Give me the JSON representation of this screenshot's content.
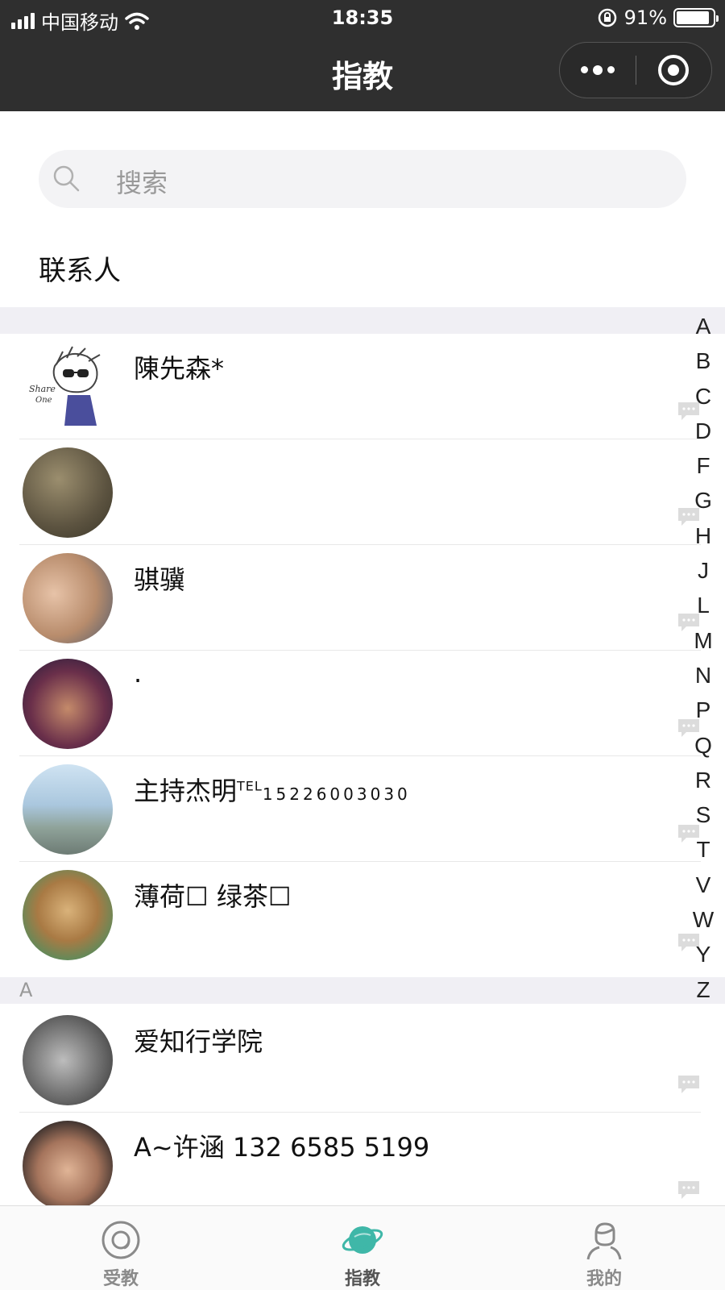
{
  "status_bar": {
    "carrier": "中国移动",
    "time": "18:35",
    "battery": "91%",
    "battery_level": 0.91
  },
  "navbar": {
    "title": "指教"
  },
  "search": {
    "placeholder": "搜索"
  },
  "contacts_section": {
    "title": "联系人"
  },
  "groups": [
    {
      "label": "",
      "contacts": [
        {
          "name": "陳先森*",
          "avatar": "cartoon-sunglasses-avatar"
        },
        {
          "name": "",
          "avatar": "photo-avatar"
        },
        {
          "name": "骐骥",
          "avatar": "photo-avatar"
        },
        {
          "name": "·",
          "avatar": "photo-avatar"
        },
        {
          "name": "主持杰明",
          "name_sup": "TEL",
          "name_tel": "15226003030",
          "avatar": "photo-avatar"
        },
        {
          "name": "薄荷☐ 绿茶☐",
          "avatar": "teddy-bear-avatar"
        }
      ]
    },
    {
      "label": "A",
      "contacts": [
        {
          "name": "爱知行学院",
          "avatar": "photo-avatar"
        },
        {
          "name": "A~许涵 132 6585 5199",
          "avatar": "photo-avatar"
        }
      ]
    }
  ],
  "index_letters": [
    "A",
    "B",
    "C",
    "D",
    "F",
    "G",
    "H",
    "J",
    "L",
    "M",
    "N",
    "P",
    "Q",
    "R",
    "S",
    "T",
    "V",
    "W",
    "Y",
    "Z"
  ],
  "tabs": [
    {
      "label": "受教",
      "icon": "circle-at-icon",
      "active": false
    },
    {
      "label": "指教",
      "icon": "planet-icon",
      "active": true
    },
    {
      "label": "我的",
      "icon": "person-icon",
      "active": false
    }
  ],
  "colors": {
    "header_bg": "#2f2f2f",
    "group_bar_bg": "#f0eff4",
    "active_tab": "#3fb7a8"
  }
}
